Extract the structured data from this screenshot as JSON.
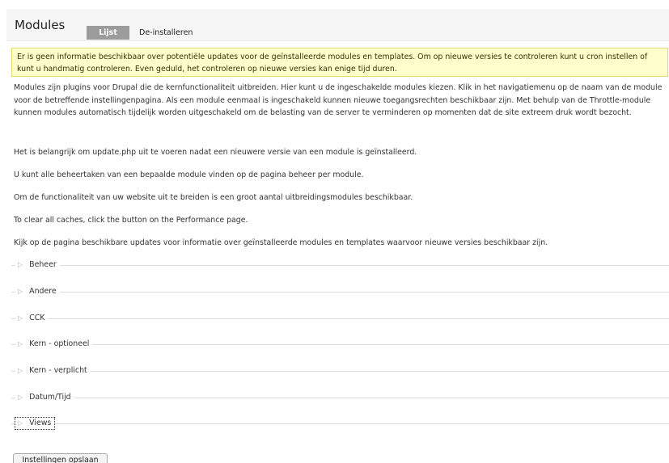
{
  "header": {
    "title": "Modules",
    "tabs": [
      {
        "label": "Lijst",
        "active": true
      },
      {
        "label": "De-installeren",
        "active": false
      }
    ]
  },
  "warning": {
    "text_before": "Er is geen informatie beschikbaar over potentiële updates voor de geïnstalleerde modules en templates. Om op nieuwe versies te controleren kunt u ",
    "link1": "cron instellen",
    "text_middle": " of kunt u ",
    "link2": "handmatig controleren",
    "text_after": ". Even geduld, het controleren op nieuwe versies kan enige tijd duren."
  },
  "intro": {
    "text": "Modules zijn plugins voor Drupal die de kernfunctionaliteit uitbreiden. Hier kunt u de ingeschakelde modules kiezen. Klik in het navigatiemenu op de naam van de module voor de betreffende instellingenpagina. Als een module eenmaal is ingeschakeld kunnen nieuwe toegangsrechten beschikbaar zijn. Met behulp van de Throttle-module kunnen modules automatisch tijdelijk worden uitgeschakeld om de belasting van de server te verminderen op momenten dat de site extreem druk wordt bezocht."
  },
  "update_note": {
    "before": "Het is belangrijk om ",
    "link": "update.php",
    "after": " uit te voeren nadat een nieuwere versie van een module is geïnstalleerd."
  },
  "admin_note": {
    "before": "U kunt alle beheertaken van een bepaalde module vinden op de pagina ",
    "link": "beheer per module",
    "after": "."
  },
  "extend_note": {
    "before": "Om de functionaliteit van uw website uit te breiden is een groot aantal ",
    "link": "uitbreidingsmodules",
    "after": " beschikbaar."
  },
  "cache_note": {
    "before": "To clear all caches, click the button on the ",
    "link": "Performance page",
    "after": "."
  },
  "updates_note": {
    "before": "Kijk op de pagina ",
    "link": "beschikbare updates",
    "after": " voor informatie over geïnstalleerde modules en templates waarvoor nieuwe versies beschikbaar zijn."
  },
  "fieldsets": [
    {
      "label": "Beheer",
      "focused": false
    },
    {
      "label": "Andere",
      "focused": false
    },
    {
      "label": "CCK",
      "focused": false
    },
    {
      "label": "Kern - optioneel",
      "focused": false
    },
    {
      "label": "Kern - verplicht",
      "focused": false
    },
    {
      "label": "Datum/Tijd",
      "focused": false
    },
    {
      "label": "Views",
      "focused": true
    }
  ],
  "fieldset_icon": "collapsed-triangle-icon",
  "submit_label": "Instellingen opslaan"
}
